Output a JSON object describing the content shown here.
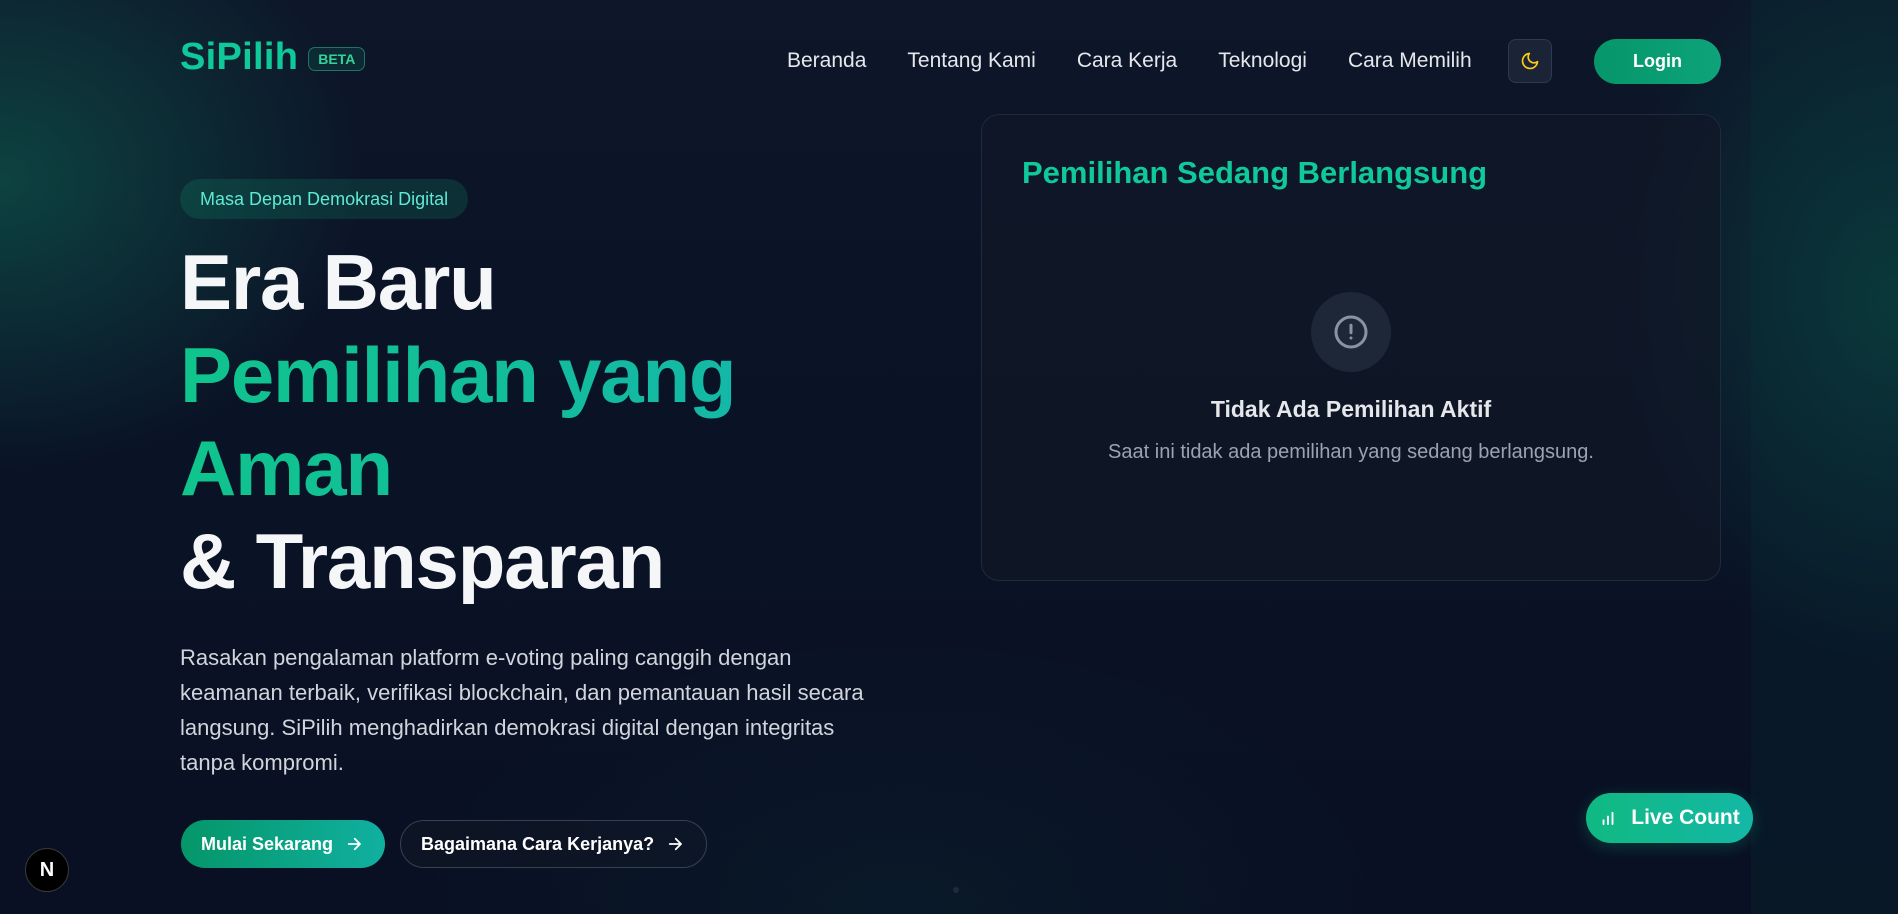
{
  "brand": {
    "name": "SiPilih",
    "badge": "BETA"
  },
  "nav": {
    "items": [
      "Beranda",
      "Tentang Kami",
      "Cara Kerja",
      "Teknologi",
      "Cara Memilih"
    ],
    "theme_toggle_icon": "moon-icon",
    "login_label": "Login"
  },
  "hero": {
    "badge": "Masa Depan Demokrasi Digital",
    "title_line1": "Era Baru",
    "title_line2": "Pemilihan yang",
    "title_line3": "Aman",
    "title_line4": "& Transparan",
    "description": "Rasakan pengalaman platform e-voting paling canggih dengan keamanan terbaik, verifikasi blockchain, dan pemantauan hasil secara langsung. SiPilih menghadirkan demokrasi digital dengan integritas tanpa kompromi.",
    "primary_cta": "Mulai Sekarang",
    "secondary_cta": "Bagaimana Cara Kerjanya?"
  },
  "election_card": {
    "title": "Pemilihan Sedang Berlangsung",
    "empty_icon": "alert-circle-icon",
    "empty_title": "Tidak Ada Pemilihan Aktif",
    "empty_description": "Saat ini tidak ada pemilihan yang sedang berlangsung."
  },
  "live_count": {
    "label": "Live Count",
    "icon": "bar-chart-icon"
  },
  "dev_indicator": {
    "label": "N"
  },
  "colors": {
    "accent": "#10c99a",
    "accent_dark": "#059669",
    "background": "#0a1226",
    "card_bg": "#111827",
    "text": "#e5e7eb",
    "muted": "#9ca3af",
    "moon": "#facc15"
  }
}
